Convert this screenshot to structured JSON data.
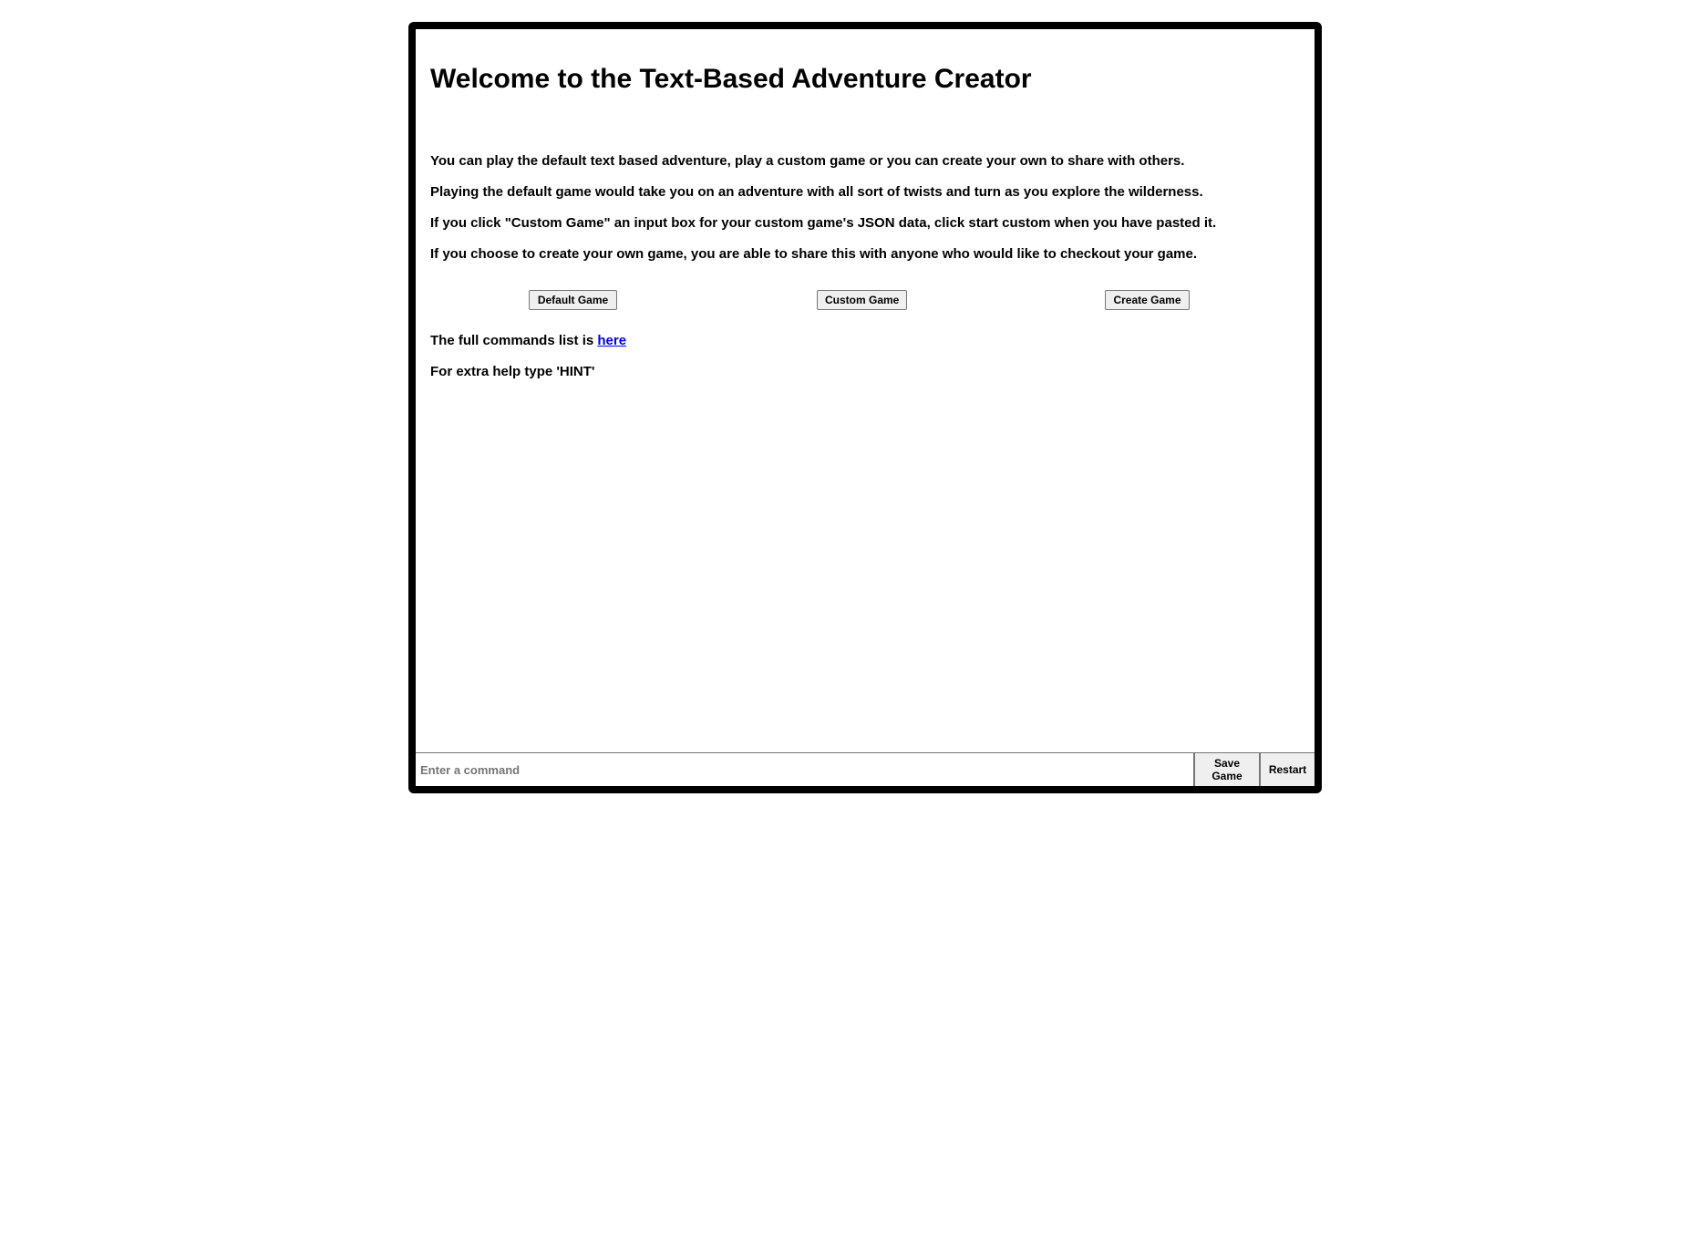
{
  "page": {
    "title": "Welcome to the Text-Based Adventure Creator",
    "intro": [
      "You can play the default text based adventure, play a custom game or you can create your own to share with others.",
      "Playing the default game would take you on an adventure with all sort of twists and turn as you explore the wilderness.",
      "If you click \"Custom Game\" an input box for your custom game's JSON data, click start custom when you have pasted it.",
      "If you choose to create your own game, you are able to share this with anyone who would like to checkout your game."
    ]
  },
  "buttons": {
    "default_game": "Default Game",
    "custom_game": "Custom Game",
    "create_game": "Create Game"
  },
  "commands": {
    "prefix": "The full commands list is ",
    "link_text": "here"
  },
  "hint": "For extra help type 'HINT'",
  "command_bar": {
    "placeholder": "Enter a command",
    "value": "",
    "save_label": "Save Game",
    "restart_label": "Restart"
  },
  "colors": {
    "frame_border": "#000000",
    "link": "#0000ee",
    "button_bg": "#efefef"
  }
}
